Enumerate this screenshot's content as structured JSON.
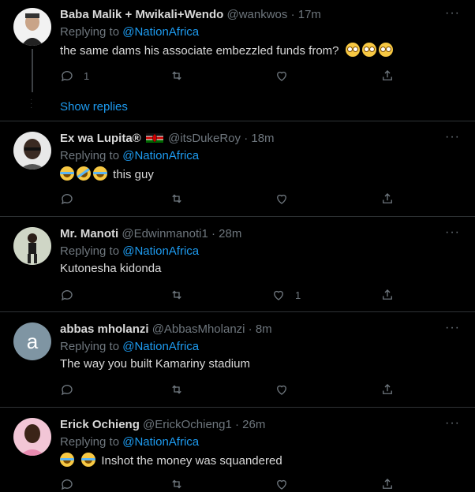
{
  "tweets": [
    {
      "name": "Baba Malik + Mwikali+Wendo",
      "handle": "@wankwos",
      "time": "17m",
      "reply_prefix": "Replying to",
      "mention": "@NationAfrica",
      "text": "the same dams his associate embezzled funds from?",
      "emojis": [
        "flushed",
        "flushed",
        "flushed"
      ],
      "counts": {
        "reply": "1",
        "retweet": "",
        "like": ""
      }
    },
    {
      "name": "Ex wa Lupita®",
      "flag": "kenya-flag",
      "handle": "@itsDukeRoy",
      "time": "18m",
      "reply_prefix": "Replying to",
      "mention": "@NationAfrica",
      "text": "this guy",
      "emojis": [
        "joy",
        "rofl",
        "joy"
      ],
      "counts": {
        "reply": "",
        "retweet": "",
        "like": ""
      }
    },
    {
      "name": "Mr. Manoti",
      "handle": "@Edwinmanoti1",
      "time": "28m",
      "reply_prefix": "Replying to",
      "mention": "@NationAfrica",
      "text": "Kutonesha kidonda",
      "counts": {
        "reply": "",
        "retweet": "",
        "like": "1"
      }
    },
    {
      "name": "abbas mholanzi",
      "handle": "@AbbasMholanzi",
      "time": "8m",
      "avatar_letter": "a",
      "reply_prefix": "Replying to",
      "mention": "@NationAfrica",
      "text": "The way you built Kamariny stadium",
      "counts": {
        "reply": "",
        "retweet": "",
        "like": ""
      }
    },
    {
      "name": "Erick Ochieng",
      "handle": "@ErickOchieng1",
      "time": "26m",
      "reply_prefix": "Replying to",
      "mention": "@NationAfrica",
      "text": "Inshot the money was squandered",
      "emojis": [
        "joy",
        "joy"
      ],
      "counts": {
        "reply": "",
        "retweet": "",
        "like": ""
      }
    }
  ],
  "show_replies": "Show replies",
  "separator": "·",
  "more_glyph": "···",
  "colors": {
    "background": "#000000",
    "link": "#1d9bf0",
    "muted": "#6e767d",
    "text": "#d9d9d9",
    "divider": "#2f3336"
  }
}
